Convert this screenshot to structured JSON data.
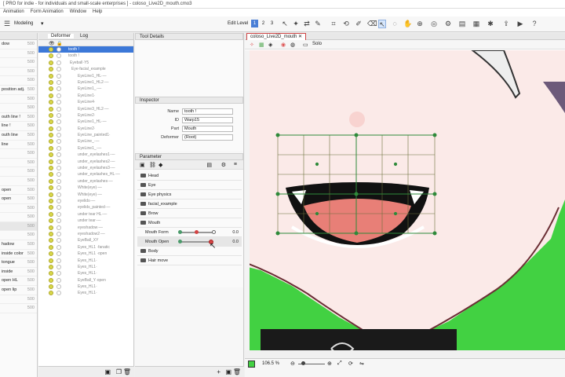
{
  "title": "[ PRO for indie - for individuals and small-scale enterprises ] - coloso_Live2D_mouth.cmo3",
  "menu": [
    "Animation",
    "Form Animation",
    "Window",
    "Help"
  ],
  "mode_label": "Modeling",
  "edit_level_label": "Edit Level",
  "edit_levels": [
    "1",
    "2",
    "3"
  ],
  "left_tab": "",
  "left_rows": [
    {
      "t": "dow",
      "v": "500"
    },
    {
      "t": "",
      "v": "500"
    },
    {
      "t": "",
      "v": "500"
    },
    {
      "t": "",
      "v": "500"
    },
    {
      "t": "",
      "v": "500"
    },
    {
      "t": "position adj.",
      "v": "500"
    },
    {
      "t": "",
      "v": "500"
    },
    {
      "t": "",
      "v": "500"
    },
    {
      "t": "outh line !",
      "v": "500"
    },
    {
      "t": "line !",
      "v": "500"
    },
    {
      "t": "outh line",
      "v": "500"
    },
    {
      "t": "line",
      "v": "500"
    },
    {
      "t": "",
      "v": "500"
    },
    {
      "t": "",
      "v": "500"
    },
    {
      "t": "",
      "v": "500"
    },
    {
      "t": "",
      "v": "500"
    },
    {
      "t": "open",
      "v": "500"
    },
    {
      "t": "open",
      "v": "500"
    },
    {
      "t": "",
      "v": "500"
    },
    {
      "t": "",
      "v": "500"
    },
    {
      "t": "",
      "v": "500"
    },
    {
      "t": "",
      "v": "500"
    },
    {
      "t": "hadow",
      "v": "500"
    },
    {
      "t": "inside  color",
      "v": "500"
    },
    {
      "t": "tongue",
      "v": "500"
    },
    {
      "t": "inside",
      "v": "500"
    },
    {
      "t": "open HL",
      "v": "500"
    },
    {
      "t": "open lip",
      "v": "500"
    },
    {
      "t": "",
      "v": "500"
    },
    {
      "t": "",
      "v": "500"
    }
  ],
  "deformer_tabs": [
    "Deformer",
    "Log"
  ],
  "deformer_rows": [
    "tooth !",
    "tooth !",
    "Eyeball·Y5",
    "Eye·facial_example",
    "EyeLine1_HL·—",
    "EyeLine1_HL2·—",
    "EyeLine1_·—",
    "EyeLine1·",
    "EyeLine4·",
    "EyeLine3_HL2·—",
    "EyeLine2·",
    "EyeLine1_HL·—",
    "EyeLine2·",
    "EyeLine_painted1·",
    "EyeLine_·—",
    "EyeLine1_·—",
    "under_eyelashes1·—",
    "under_eyelashes2·—",
    "under_eyelashes3·—",
    "under_eyelashes_HL·—",
    "under_eyelashes·—",
    "White(eye)·—",
    "White(eye)·—",
    "eyelids·—",
    "eyelids_painted·—",
    "under tear HL·—",
    "under tear·—",
    "eyeshadow·—",
    "eyeshadow2·—",
    "EyeBall_XY",
    "Eyes_HL1 ·fanatic",
    "Eyes_HL1 ·open",
    "Eyes_HL1·",
    "Eyes_HL1·",
    "Eyes_HL1·",
    "EyeBall_Y·open",
    "Eyes_HL1·",
    "Eyes_HL1·"
  ],
  "tool_details_label": "Tool Details",
  "inspector_label": "Inspector",
  "inspector": {
    "name_label": "Name",
    "name_value": "tooth !",
    "id_label": "ID",
    "id_value": "Warp15",
    "part_label": "Part",
    "part_value": "Mouth",
    "deformer_label": "Deformer",
    "deformer_value": "(Root)"
  },
  "parameter_label": "Parameter",
  "groups": [
    "Head",
    "Eye",
    "Eye physics",
    "facial_example",
    "Brow",
    "Mouth"
  ],
  "sliders": [
    {
      "name": "Mouth Form",
      "value": "0.0",
      "knob": 0.5
    },
    {
      "name": "Mouth Open",
      "value": "0.0",
      "knob": 0.93
    }
  ],
  "groups2": [
    "Body",
    "Hair move"
  ],
  "canvas_tab": "coloso_Live2D_mouth",
  "canvas_toolbar_label": "Solo",
  "zoom": "106.5 %",
  "colors": {
    "green": "#42d142",
    "skin": "#fbeae8",
    "mouth": "#111111",
    "tongue": "#e87f77",
    "outline": "#6b2f35"
  }
}
